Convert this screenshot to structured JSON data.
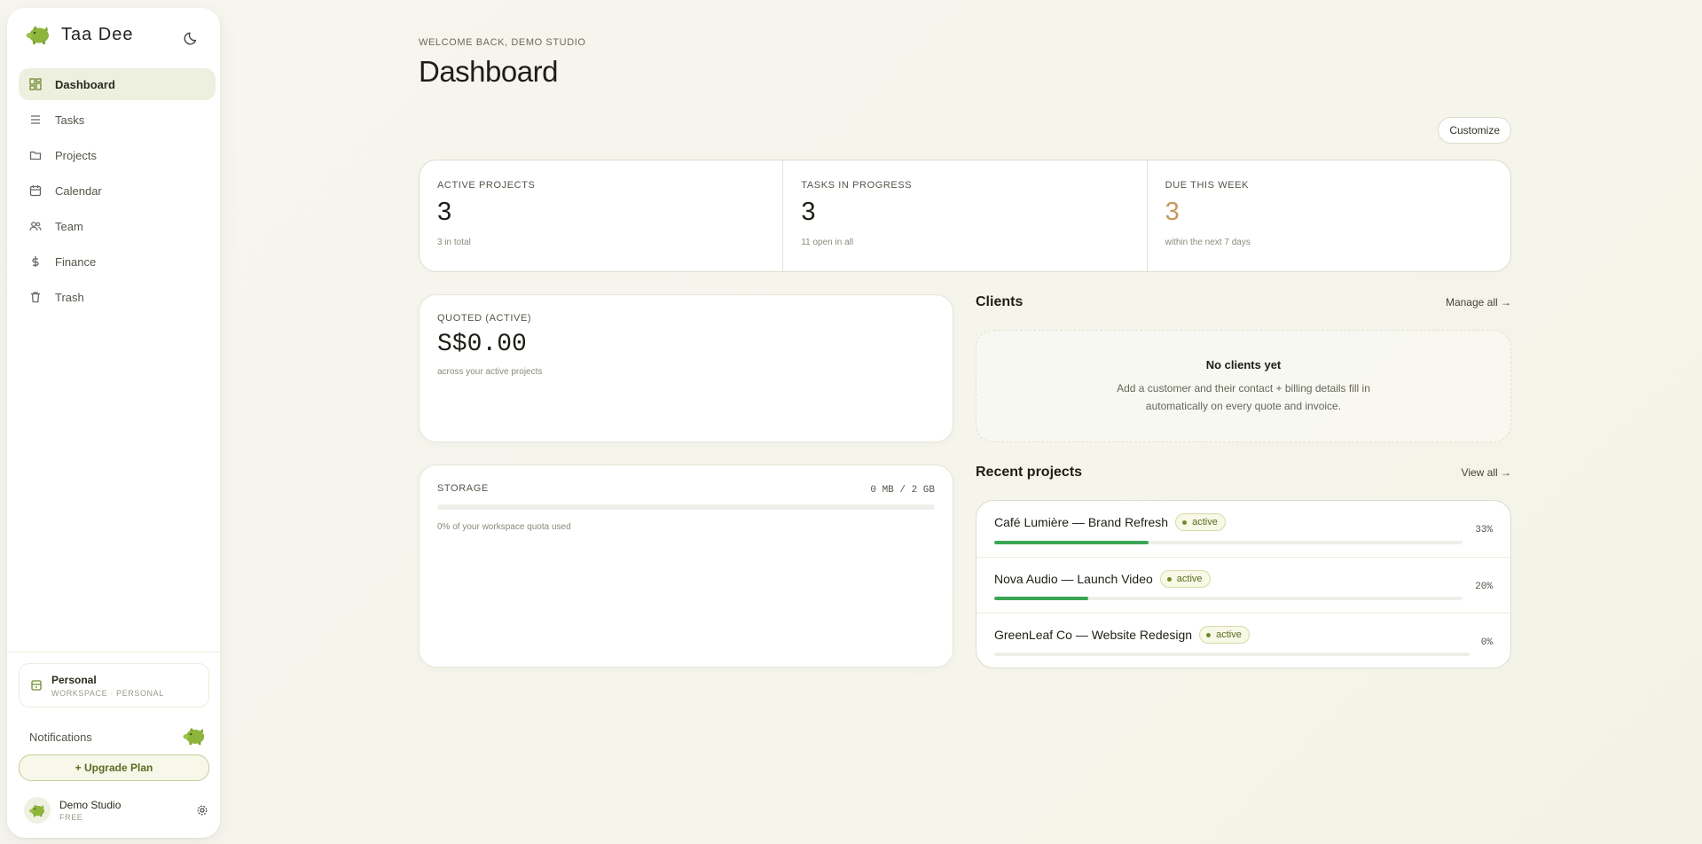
{
  "brand": {
    "name": "Taa Dee"
  },
  "sidebar": {
    "items": [
      {
        "label": "Dashboard",
        "icon": "dashboard-icon",
        "active": true
      },
      {
        "label": "Tasks",
        "icon": "list-icon",
        "active": false
      },
      {
        "label": "Projects",
        "icon": "folder-icon",
        "active": false
      },
      {
        "label": "Calendar",
        "icon": "calendar-icon",
        "active": false
      },
      {
        "label": "Team",
        "icon": "team-icon",
        "active": false
      },
      {
        "label": "Finance",
        "icon": "dollar-icon",
        "active": false
      },
      {
        "label": "Trash",
        "icon": "trash-icon",
        "active": false
      }
    ],
    "workspace": {
      "name": "Personal",
      "sub": "WORKSPACE · PERSONAL"
    },
    "notifications_label": "Notifications",
    "upgrade_label": "+ Upgrade Plan",
    "user": {
      "name": "Demo Studio",
      "plan": "FREE"
    }
  },
  "header": {
    "eyebrow": "WELCOME BACK, DEMO STUDIO",
    "title": "Dashboard",
    "customize_label": "Customize"
  },
  "stats": [
    {
      "label": "ACTIVE PROJECTS",
      "value": "3",
      "sub": "3 in total"
    },
    {
      "label": "TASKS IN PROGRESS",
      "value": "3",
      "sub": "11 open in all"
    },
    {
      "label": "DUE THIS WEEK",
      "value": "3",
      "sub": "within the next 7 days"
    }
  ],
  "quoted": {
    "label": "QUOTED (ACTIVE)",
    "value": "S$0.00",
    "sub": "across your active projects"
  },
  "storage": {
    "label": "STORAGE",
    "usage": "0 MB / 2 GB",
    "percent": 0,
    "sub": "0% of your workspace quota used"
  },
  "clients": {
    "title": "Clients",
    "link": "Manage all →",
    "empty_title": "No clients yet",
    "empty_text": "Add a customer and their contact + billing details fill in automatically on every quote and invoice."
  },
  "recent_projects": {
    "title": "Recent projects",
    "link": "View all →",
    "items": [
      {
        "name": "Café Lumière — Brand Refresh",
        "status": "active",
        "progress": 33,
        "progress_label": "33%"
      },
      {
        "name": "Nova Audio — Launch Video",
        "status": "active",
        "progress": 20,
        "progress_label": "20%"
      },
      {
        "name": "GreenLeaf Co — Website Redesign",
        "status": "active",
        "progress": 0,
        "progress_label": "0%"
      }
    ]
  },
  "colors": {
    "accent": "#3aa655",
    "brand": "#8db53c",
    "warn": "#c69a5c",
    "active_nav": "#eef0df"
  }
}
